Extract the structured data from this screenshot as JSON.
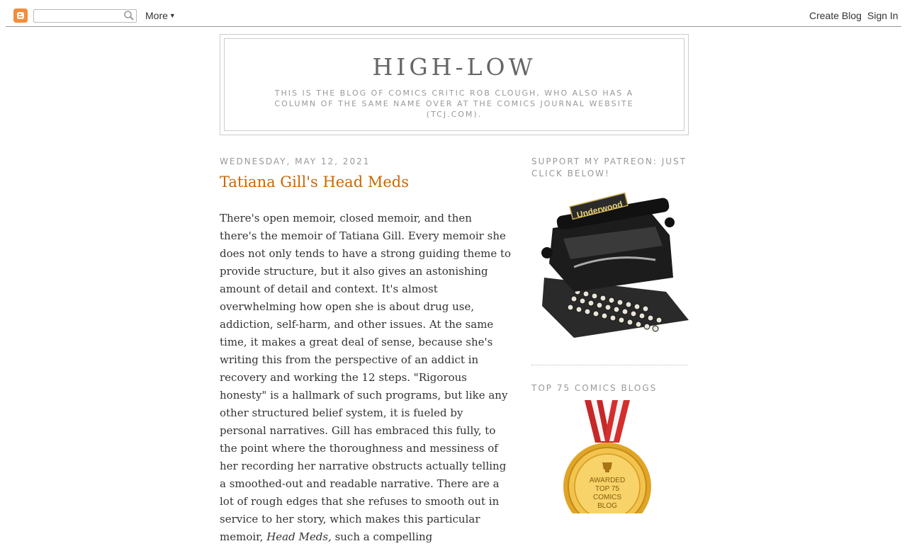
{
  "navbar": {
    "logo_icon": "blogger-icon",
    "search": {
      "value": "",
      "placeholder": ""
    },
    "more_label": "More",
    "create_blog_label": "Create Blog",
    "sign_in_label": "Sign In"
  },
  "header": {
    "title": "HIGH-LOW",
    "description": "This is the blog of comics critic Rob Clough, who also has a column of the same name over at the Comics Journal website (tcj.com)."
  },
  "post": {
    "date": "Wednesday, May 12, 2021",
    "title": "Tatiana Gill's Head Meds",
    "body_before_italic": "There's open memoir, closed memoir, and then there's the memoir of Tatiana Gill. Every memoir she does not only tends to have a strong guiding theme to provide structure, but it also gives an astonishing amount of detail and context. It's almost overwhelming how open she is about drug use, addiction, self-harm, and other issues. At the same time, it makes a great deal of sense, because she's writing this from the perspective of an addict in recovery and working the 12 steps. \"Rigorous honesty\" is a hallmark of such programs, but like any other structured belief system, it is fueled by personal narratives. Gill has embraced this fully, to the point where the thoroughness and messiness of her recording her narrative obstructs actually telling a smoothed-out and readable narrative. There are a lot of rough edges that she refuses to smooth out in service to her story, which makes this particular memoir, ",
    "body_italic": "Head Meds,",
    "body_after_italic": " such a compelling"
  },
  "sidebar": {
    "patreon_heading": "Support my Patreon: Just click below!",
    "patreon_image_icon": "typewriter-image",
    "top_blogs_heading": "Top 75 Comics Blogs",
    "medal_icon": "award-medal-image",
    "medal_text": [
      "AWARDED",
      "TOP 75",
      "COMICS",
      "BLOG"
    ]
  },
  "colors": {
    "post_title": "#cc6600",
    "muted_text": "#999999",
    "body_text": "#333333"
  }
}
